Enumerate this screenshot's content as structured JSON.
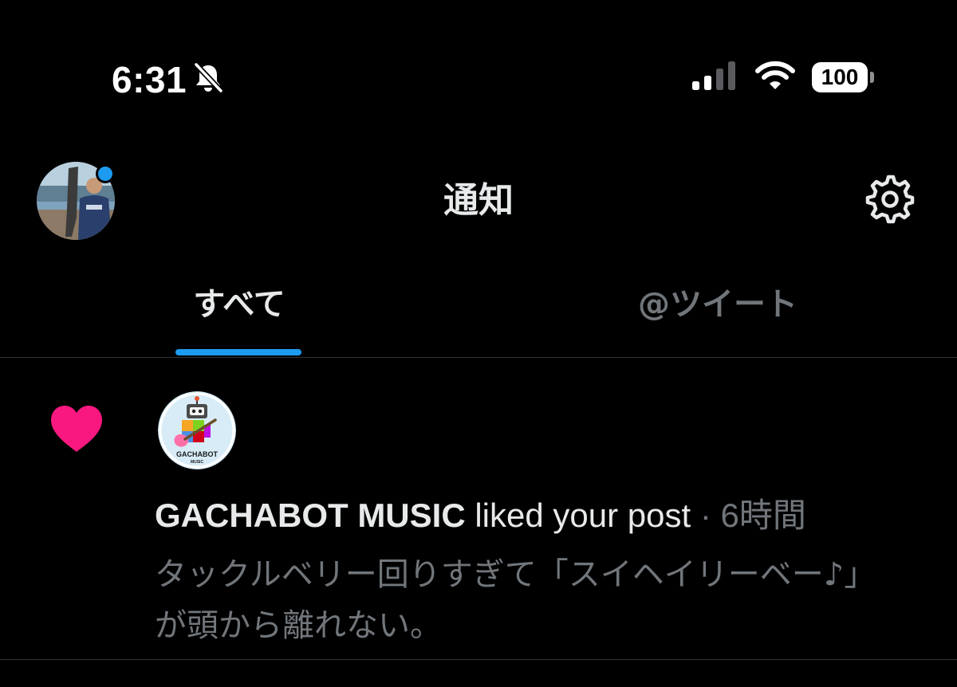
{
  "status_bar": {
    "time": "6:31",
    "battery_level": "100",
    "cellular_bars_active": 2,
    "cellular_bars_total": 4,
    "icons": [
      "bell-slash-icon",
      "signal-icon",
      "wifi-icon",
      "battery-icon"
    ]
  },
  "header": {
    "title": "通知",
    "avatar_icon": "profile-avatar",
    "settings_icon": "gear-icon"
  },
  "tabs": [
    {
      "label": "すべて",
      "selected": true
    },
    {
      "label": "@ツイート",
      "selected": false
    }
  ],
  "notifications": [
    {
      "type_icon": "heart-icon",
      "actor": "GACHABOT MUSIC",
      "action": "liked your post",
      "separator": "·",
      "time": "6時間",
      "snippet": "タックルベリー回りすぎて「スイヘイリーベー♪」が頭から離れない。",
      "avatar_text": "GACHABOT",
      "avatar_subtext": "MUSIC"
    }
  ],
  "colors": {
    "background": "#000000",
    "text_primary": "#e7e9ea",
    "text_secondary": "#71767b",
    "accent": "#1d9bf0",
    "like": "#f91880",
    "divider": "#2f3336"
  }
}
